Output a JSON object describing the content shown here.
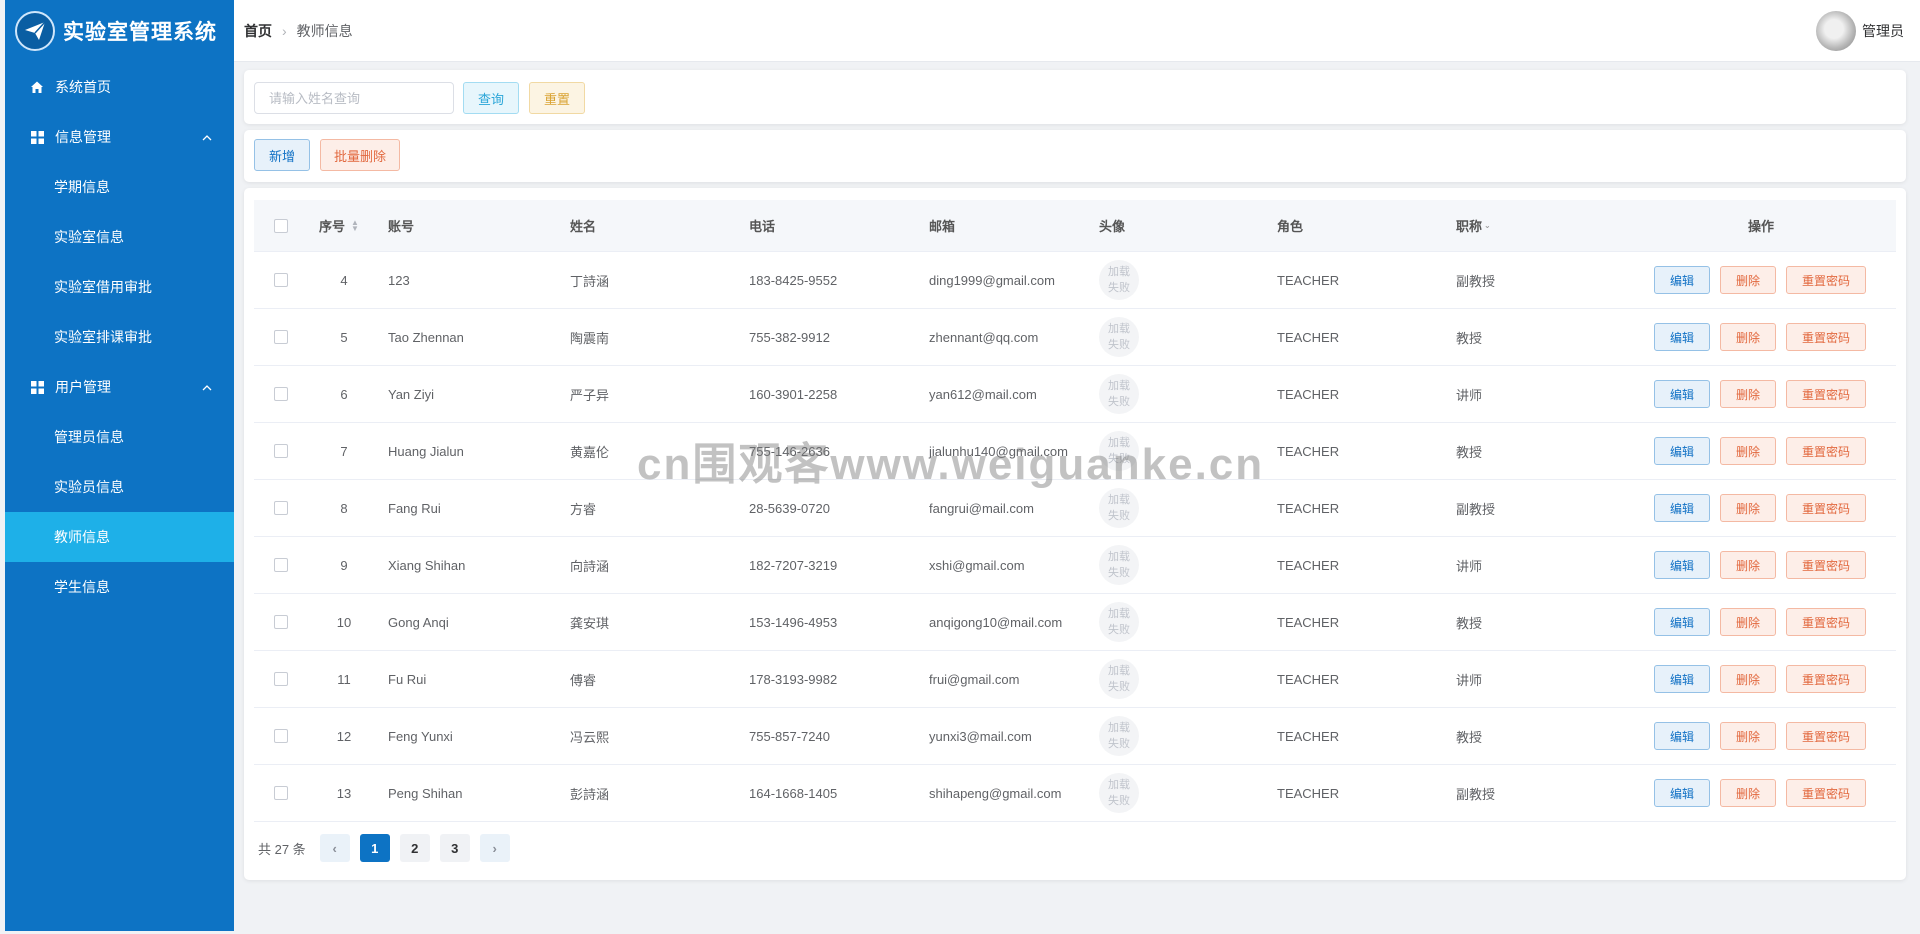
{
  "app": {
    "title": "实验室管理系统"
  },
  "sidebar": {
    "home": "系统首页",
    "info_mgmt": "信息管理",
    "info_items": [
      "学期信息",
      "实验室信息",
      "实验室借用审批",
      "实验室排课审批"
    ],
    "user_mgmt": "用户管理",
    "user_items": [
      "管理员信息",
      "实验员信息",
      "教师信息",
      "学生信息"
    ],
    "active": "教师信息"
  },
  "header": {
    "breadcrumb_home": "首页",
    "breadcrumb_current": "教师信息",
    "username": "管理员"
  },
  "search": {
    "placeholder": "请输入姓名查询",
    "query_label": "查询",
    "reset_label": "重置"
  },
  "actions": {
    "add_label": "新增",
    "batch_delete_label": "批量删除"
  },
  "table": {
    "columns": [
      "序号",
      "账号",
      "姓名",
      "电话",
      "邮箱",
      "头像",
      "角色",
      "职称",
      "操作"
    ],
    "avatar_fail_top": "加载",
    "avatar_fail_bottom": "失败",
    "op_edit": "编辑",
    "op_delete": "删除",
    "op_reset": "重置密码",
    "rows": [
      {
        "id": "4",
        "account": "123",
        "name": "丁詩涵",
        "phone": "183-8425-9552",
        "email": "ding1999@gmail.com",
        "role": "TEACHER",
        "title": "副教授"
      },
      {
        "id": "5",
        "account": "Tao Zhennan",
        "name": "陶震南",
        "phone": "755-382-9912",
        "email": "zhennant@qq.com",
        "role": "TEACHER",
        "title": "教授"
      },
      {
        "id": "6",
        "account": "Yan Ziyi",
        "name": "严子异",
        "phone": "160-3901-2258",
        "email": "yan612@mail.com",
        "role": "TEACHER",
        "title": "讲师"
      },
      {
        "id": "7",
        "account": "Huang Jialun",
        "name": "黄嘉伦",
        "phone": "755-146-2636",
        "email": "jialunhu140@gmail.com",
        "role": "TEACHER",
        "title": "教授"
      },
      {
        "id": "8",
        "account": "Fang Rui",
        "name": "方睿",
        "phone": "28-5639-0720",
        "email": "fangrui@mail.com",
        "role": "TEACHER",
        "title": "副教授"
      },
      {
        "id": "9",
        "account": "Xiang Shihan",
        "name": "向詩涵",
        "phone": "182-7207-3219",
        "email": "xshi@gmail.com",
        "role": "TEACHER",
        "title": "讲师"
      },
      {
        "id": "10",
        "account": "Gong Anqi",
        "name": "龚安琪",
        "phone": "153-1496-4953",
        "email": "anqigong10@mail.com",
        "role": "TEACHER",
        "title": "教授"
      },
      {
        "id": "11",
        "account": "Fu Rui",
        "name": "傅睿",
        "phone": "178-3193-9982",
        "email": "frui@gmail.com",
        "role": "TEACHER",
        "title": "讲师"
      },
      {
        "id": "12",
        "account": "Feng Yunxi",
        "name": "冯云熙",
        "phone": "755-857-7240",
        "email": "yunxi3@mail.com",
        "role": "TEACHER",
        "title": "教授"
      },
      {
        "id": "13",
        "account": "Peng Shihan",
        "name": "彭詩涵",
        "phone": "164-1668-1405",
        "email": "shihapeng@gmail.com",
        "role": "TEACHER",
        "title": "副教授"
      }
    ]
  },
  "pagination": {
    "total_text": "共 27 条",
    "pages": [
      "1",
      "2",
      "3"
    ],
    "current": "1"
  },
  "watermark": "cn围观客www.weiguanke.cn",
  "colors": {
    "sidebar": "#0d73c4",
    "active_item": "#1eb0e8",
    "page_bg": "#f0f2f5"
  }
}
